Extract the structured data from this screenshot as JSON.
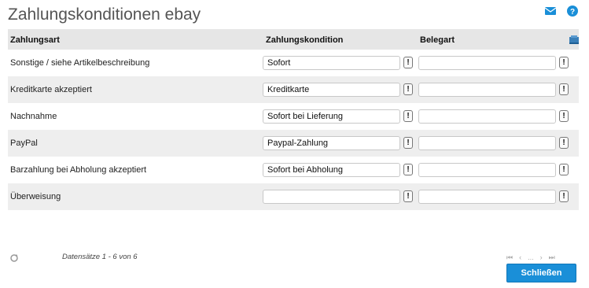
{
  "window": {
    "title": "Zahlungskonditionen ebay"
  },
  "icons": {
    "mail": "mail-icon",
    "help": "help-icon",
    "settings": "column-settings-icon",
    "refresh": "refresh-icon"
  },
  "table": {
    "headers": {
      "zahlungsart": "Zahlungsart",
      "zahlungskondition": "Zahlungskondition",
      "belegart": "Belegart"
    },
    "rows": [
      {
        "zahlungsart": "Sonstige / siehe Artikelbeschreibung",
        "zahlungskondition": "Sofort",
        "belegart": ""
      },
      {
        "zahlungsart": "Kreditkarte akzeptiert",
        "zahlungskondition": "Kreditkarte",
        "belegart": ""
      },
      {
        "zahlungsart": "Nachnahme",
        "zahlungskondition": "Sofort bei Lieferung",
        "belegart": ""
      },
      {
        "zahlungsart": "PayPal",
        "zahlungskondition": "Paypal-Zahlung",
        "belegart": ""
      },
      {
        "zahlungsart": "Barzahlung bei Abholung akzeptiert",
        "zahlungskondition": "Sofort bei Abholung",
        "belegart": ""
      },
      {
        "zahlungsart": "Überweisung",
        "zahlungskondition": "",
        "belegart": ""
      }
    ],
    "row_button_label": "!"
  },
  "footer": {
    "records_text": "Datensätze 1 - 6 von 6",
    "pager": {
      "first": "⏮",
      "prev": "‹",
      "ellipsis": "...",
      "next": "›",
      "last": "⏭"
    },
    "close_label": "Schließen"
  },
  "colors": {
    "accent": "#1a8fd8",
    "header_bg": "#e6e6e6",
    "row_alt_bg": "#eeeeee"
  }
}
